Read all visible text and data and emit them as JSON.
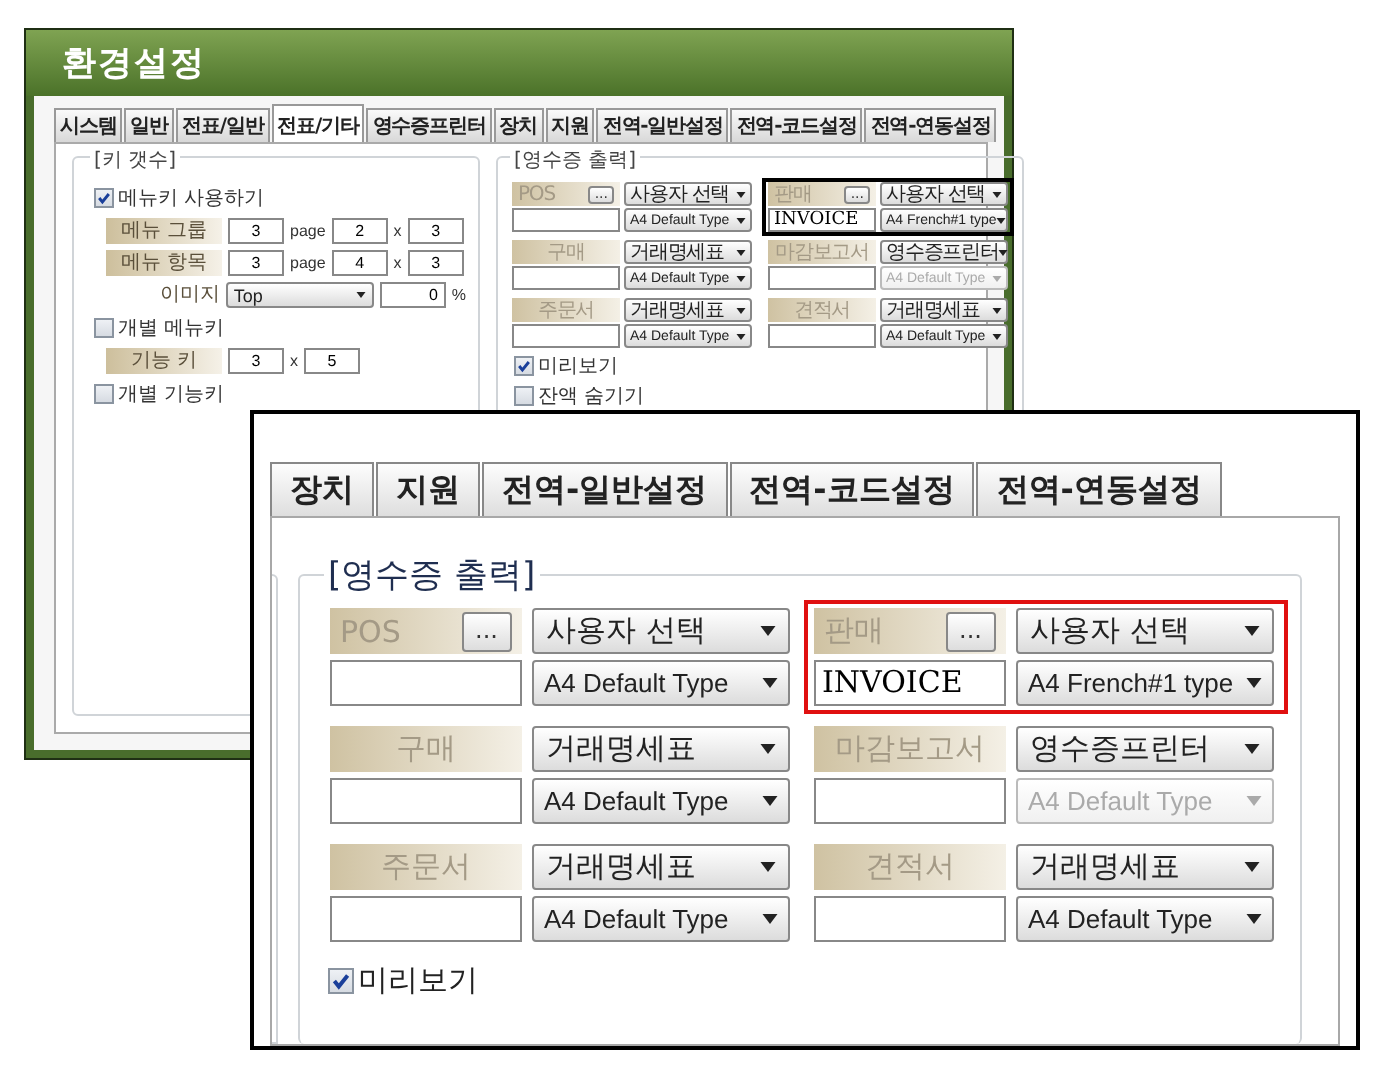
{
  "background_window": {
    "title": "환경설정",
    "tabs": [
      {
        "label": "시스템",
        "selected": false
      },
      {
        "label": "일반",
        "selected": false
      },
      {
        "label": "전표/일반",
        "selected": false
      },
      {
        "label": "전표/기타",
        "selected": true
      },
      {
        "label": "영수증프린터",
        "selected": false
      },
      {
        "label": "장치",
        "selected": false
      },
      {
        "label": "지원",
        "selected": false
      },
      {
        "label": "전역-일반설정",
        "selected": false
      },
      {
        "label": "전역-코드설정",
        "selected": false
      },
      {
        "label": "전역-연동설정",
        "selected": false
      }
    ],
    "key_panel": {
      "title": "[키 갯수]",
      "items": [
        {
          "kind": "checkbox",
          "label": "메뉴키 사용하기",
          "checked": true
        },
        {
          "kind": "paged",
          "label": "메뉴 그룹",
          "pages": "3",
          "unit": "page",
          "columns": "2",
          "times": "x",
          "rows": "3"
        },
        {
          "kind": "paged",
          "label": "메뉴 항목",
          "pages": "3",
          "unit": "page",
          "columns": "4",
          "times": "x",
          "rows": "3"
        },
        {
          "kind": "image",
          "label": "이미지",
          "select": "Top",
          "value": "0",
          "unit": "%"
        },
        {
          "kind": "checkbox",
          "label": "개별 메뉴키",
          "checked": false
        },
        {
          "kind": "grid",
          "label": "기능 키",
          "columns": "3",
          "times": "x",
          "rows": "5"
        },
        {
          "kind": "checkbox",
          "label": "개별 기능키",
          "checked": false
        }
      ]
    },
    "receipt_panel": {
      "title": "[영수증 출력]",
      "blocks": [
        {
          "label": "POS",
          "button": "...",
          "printer": "사용자 선택",
          "form": "A4 Default Type",
          "form_disabled": false,
          "highlighted": false
        },
        {
          "label": "판매",
          "button": "...",
          "printer": "사용자 선택",
          "form": "A4 French#1 type",
          "form_disabled": false,
          "value": "INVOICE",
          "highlighted": true
        },
        {
          "label": "구매",
          "printer": "거래명세표",
          "form": "A4 Default Type",
          "form_disabled": false,
          "highlighted": false
        },
        {
          "label": "마감보고서",
          "printer": "영수증프린터",
          "form": "A4 Default Type",
          "form_disabled": true,
          "highlighted": false
        },
        {
          "label": "주문서",
          "printer": "거래명세표",
          "form": "A4 Default Type",
          "form_disabled": false,
          "highlighted": false
        },
        {
          "label": "견적서",
          "printer": "거래명세표",
          "form": "A4 Default Type",
          "form_disabled": false,
          "highlighted": false
        }
      ],
      "options": [
        {
          "label": "미리보기",
          "checked": true
        },
        {
          "label": "잔액 숨기기",
          "checked": false
        }
      ]
    }
  },
  "zoom_inset": {
    "tabs": [
      {
        "label": "장치",
        "selected": false
      },
      {
        "label": "지원",
        "selected": false
      },
      {
        "label": "전역-일반설정",
        "selected": false
      },
      {
        "label": "전역-코드설정",
        "selected": false
      },
      {
        "label": "전역-연동설정",
        "selected": false
      }
    ],
    "receipt_panel": {
      "title": "[영수증 출력]",
      "blocks": [
        {
          "label": "POS",
          "button": "...",
          "printer": "사용자 선택",
          "form": "A4 Default Type",
          "form_disabled": false,
          "highlighted": false
        },
        {
          "label": "판매",
          "button": "...",
          "printer": "사용자 선택",
          "form": "A4 French#1 type",
          "form_disabled": false,
          "value": "INVOICE",
          "highlighted": true
        },
        {
          "label": "구매",
          "printer": "거래명세표",
          "form": "A4 Default Type",
          "form_disabled": false,
          "highlighted": false
        },
        {
          "label": "마감보고서",
          "printer": "영수증프린터",
          "form": "A4 Default Type",
          "form_disabled": true,
          "highlighted": false
        },
        {
          "label": "주문서",
          "printer": "거래명세표",
          "form": "A4 Default Type",
          "form_disabled": false,
          "highlighted": false
        },
        {
          "label": "견적서",
          "printer": "거래명세표",
          "form": "A4 Default Type",
          "form_disabled": false,
          "highlighted": false
        }
      ],
      "options": [
        {
          "label": "미리보기",
          "checked": true
        }
      ]
    }
  }
}
